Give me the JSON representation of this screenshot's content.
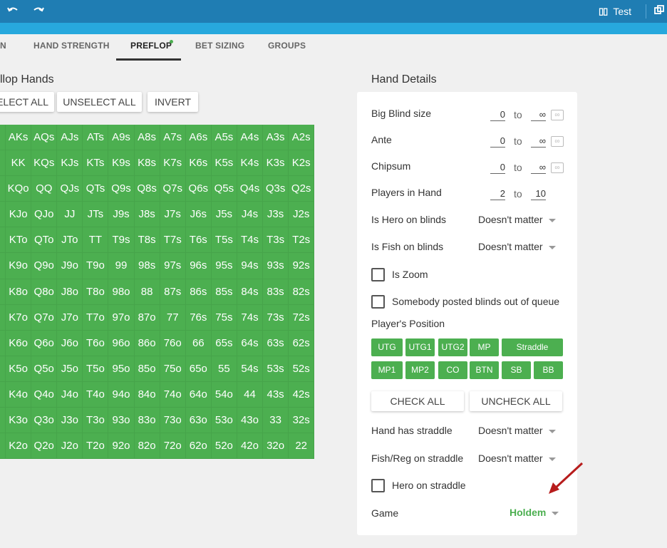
{
  "topbar": {
    "undo_icon": "undo-icon",
    "redo_icon": "redo-icon",
    "test_label": "Test",
    "test_icon": "book-icon",
    "window_icon": "window-restore-icon",
    "color": "#1f7db3",
    "strip_color": "#27a8dd"
  },
  "tabs": [
    {
      "label": "N"
    },
    {
      "label": "HAND STRENGTH"
    },
    {
      "label": "PREFLOP"
    },
    {
      "label": "BET SIZING"
    },
    {
      "label": "GROUPS"
    }
  ],
  "active_tab": "PREFLOP",
  "preflop": {
    "title": "llop Hands",
    "buttons": {
      "select_all": "ELECT ALL",
      "unselect_all": "UNSELECT ALL",
      "invert": "INVERT"
    },
    "cell_color": "#4caf50",
    "grid": [
      [
        "",
        "AKs",
        "AQs",
        "AJs",
        "ATs",
        "A9s",
        "A8s",
        "A7s",
        "A6s",
        "A5s",
        "A4s",
        "A3s",
        "A2s"
      ],
      [
        "o",
        "KK",
        "KQs",
        "KJs",
        "KTs",
        "K9s",
        "K8s",
        "K7s",
        "K6s",
        "K5s",
        "K4s",
        "K3s",
        "K2s"
      ],
      [
        "o",
        "KQo",
        "QQ",
        "QJs",
        "QTs",
        "Q9s",
        "Q8s",
        "Q7s",
        "Q6s",
        "Q5s",
        "Q4s",
        "Q3s",
        "Q2s"
      ],
      [
        "o",
        "KJo",
        "QJo",
        "JJ",
        "JTs",
        "J9s",
        "J8s",
        "J7s",
        "J6s",
        "J5s",
        "J4s",
        "J3s",
        "J2s"
      ],
      [
        "o",
        "KTo",
        "QTo",
        "JTo",
        "TT",
        "T9s",
        "T8s",
        "T7s",
        "T6s",
        "T5s",
        "T4s",
        "T3s",
        "T2s"
      ],
      [
        "o",
        "K9o",
        "Q9o",
        "J9o",
        "T9o",
        "99",
        "98s",
        "97s",
        "96s",
        "95s",
        "94s",
        "93s",
        "92s"
      ],
      [
        "o",
        "K8o",
        "Q8o",
        "J8o",
        "T8o",
        "98o",
        "88",
        "87s",
        "86s",
        "85s",
        "84s",
        "83s",
        "82s"
      ],
      [
        "o",
        "K7o",
        "Q7o",
        "J7o",
        "T7o",
        "97o",
        "87o",
        "77",
        "76s",
        "75s",
        "74s",
        "73s",
        "72s"
      ],
      [
        "o",
        "K6o",
        "Q6o",
        "J6o",
        "T6o",
        "96o",
        "86o",
        "76o",
        "66",
        "65s",
        "64s",
        "63s",
        "62s"
      ],
      [
        "o",
        "K5o",
        "Q5o",
        "J5o",
        "T5o",
        "95o",
        "85o",
        "75o",
        "65o",
        "55",
        "54s",
        "53s",
        "52s"
      ],
      [
        "o",
        "K4o",
        "Q4o",
        "J4o",
        "T4o",
        "94o",
        "84o",
        "74o",
        "64o",
        "54o",
        "44",
        "43s",
        "42s"
      ],
      [
        "o",
        "K3o",
        "Q3o",
        "J3o",
        "T3o",
        "93o",
        "83o",
        "73o",
        "63o",
        "53o",
        "43o",
        "33",
        "32s"
      ],
      [
        "o",
        "K2o",
        "Q2o",
        "J2o",
        "T2o",
        "92o",
        "82o",
        "72o",
        "62o",
        "52o",
        "42o",
        "32o",
        "22"
      ]
    ]
  },
  "hand_details": {
    "title": "Hand Details",
    "big_blind": {
      "label": "Big Blind size",
      "from": "0",
      "to_word": "to",
      "to": "∞"
    },
    "ante": {
      "label": "Ante",
      "from": "0",
      "to_word": "to",
      "to": "∞"
    },
    "chipsum": {
      "label": "Chipsum",
      "from": "0",
      "to_word": "to",
      "to": "∞"
    },
    "players": {
      "label": "Players in Hand",
      "from": "2",
      "to_word": "to",
      "to": "10"
    },
    "inf_symbol": "∞",
    "hero_blinds": {
      "label": "Is Hero on blinds",
      "value": "Doesn't matter"
    },
    "fish_blinds": {
      "label": "Is Fish on blinds",
      "value": "Doesn't matter"
    },
    "is_zoom": {
      "label": "Is Zoom"
    },
    "out_of_queue": {
      "label": "Somebody posted blinds out of queue"
    },
    "positions_label": "Player's Position",
    "positions_row1": [
      "UTG",
      "UTG1",
      "UTG2",
      "MP",
      "Straddle"
    ],
    "positions_row2": [
      "MP1",
      "MP2",
      "CO",
      "BTN",
      "SB",
      "BB"
    ],
    "check_all": "CHECK ALL",
    "uncheck_all": "UNCHECK ALL",
    "has_straddle": {
      "label": "Hand has straddle",
      "value": "Doesn't matter"
    },
    "fish_reg_straddle": {
      "label": "Fish/Reg on straddle",
      "value": "Doesn't matter"
    },
    "hero_straddle": {
      "label": "Hero on straddle"
    },
    "game": {
      "label": "Game",
      "value": "Holdem",
      "color": "#4caf50"
    }
  },
  "annotation_arrow_color": "#b71c1c"
}
